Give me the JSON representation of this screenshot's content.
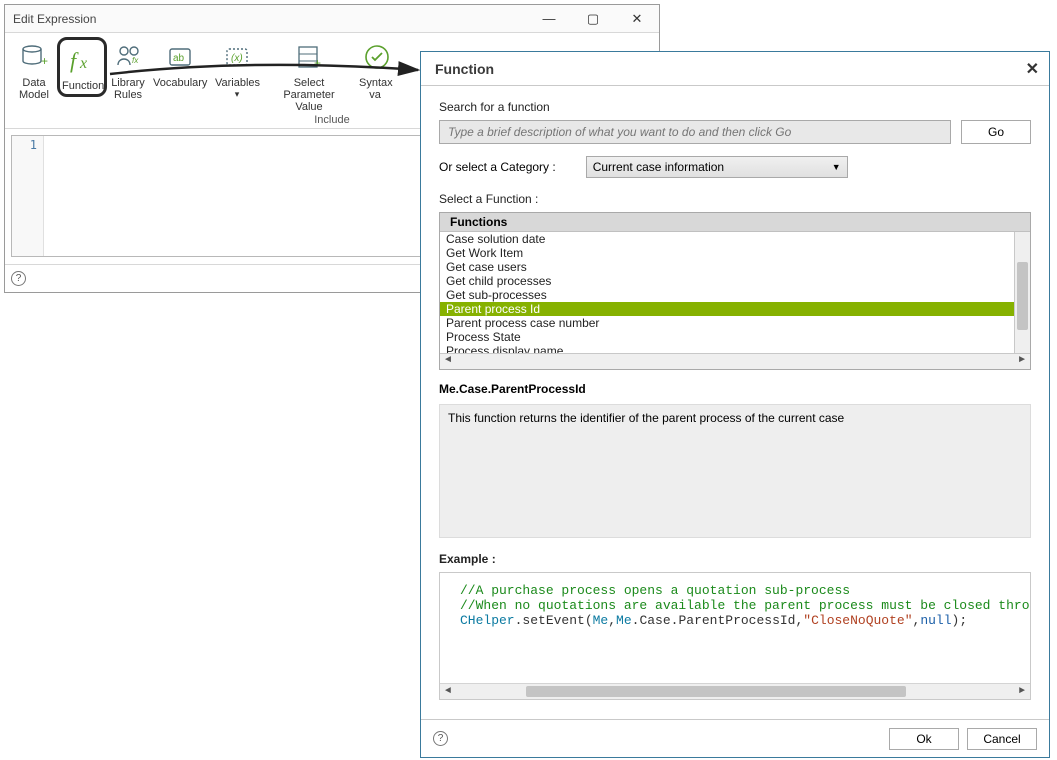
{
  "edit": {
    "title": "Edit Expression",
    "ribbon": {
      "items": [
        {
          "label_line1": "Data",
          "label_line2": "Model"
        },
        {
          "label_line1": "Function",
          "label_line2": ""
        },
        {
          "label_line1": "Library",
          "label_line2": "Rules"
        },
        {
          "label_line1": "Vocabulary",
          "label_line2": ""
        },
        {
          "label_line1": "Variables",
          "label_line2": "▾"
        },
        {
          "label_line1": "Select Parameter",
          "label_line2": "Value"
        },
        {
          "label_line1": "Syntax",
          "label_line2": "va"
        }
      ],
      "group_label": "Include"
    },
    "gutter_first": "1"
  },
  "func": {
    "title": "Function",
    "search_label": "Search for a function",
    "search_placeholder": "Type a brief description of what you want to do and then click Go",
    "go_button": "Go",
    "category_label": "Or select a Category :",
    "category_value": "Current case information",
    "select_label": "Select a Function :",
    "list_header": "Functions",
    "functions": [
      "Case solution date",
      "Get Work Item",
      "Get case users",
      "Get child processes",
      "Get sub-processes",
      "Parent process Id",
      "Parent process case number",
      "Process State",
      "Process display name"
    ],
    "selected_index": 5,
    "signature": "Me.Case.ParentProcessId",
    "description": "This function returns the identifier of the parent process of the current case",
    "example_label": "Example :",
    "example_lines": {
      "c1": "//A purchase process opens a quotation sub-process",
      "c2": "//When no quotations are available the parent process must be closed thro",
      "l3a": "CHelper",
      "l3b": ".setEvent(",
      "l3c": "Me",
      "l3d": ",",
      "l3e": "Me",
      "l3f": ".Case.ParentProcessId,",
      "l3g": "\"CloseNoQuote\"",
      "l3h": ",",
      "l3i": "null",
      "l3j": ");"
    },
    "ok": "Ok",
    "cancel": "Cancel"
  }
}
